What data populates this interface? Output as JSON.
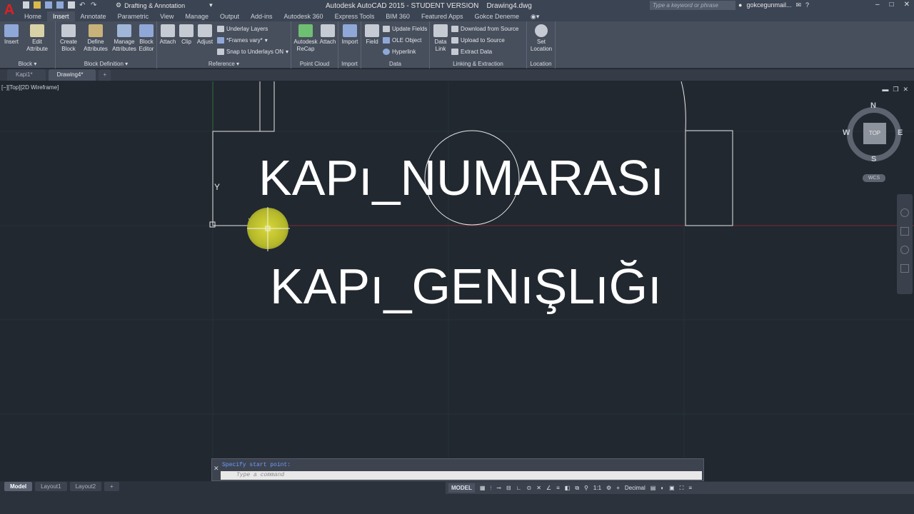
{
  "app": {
    "window_title": "Autodesk AutoCAD 2015 - STUDENT VERSION    Drawing4.dwg",
    "workspace": "Drafting & Annotation",
    "search_placeholder": "Type a keyword or phrase",
    "user": "gokcegunmail...",
    "logo": "A"
  },
  "ribbon_tabs": [
    "Home",
    "Insert",
    "Annotate",
    "Parametric",
    "View",
    "Manage",
    "Output",
    "Add-ins",
    "Autodesk 360",
    "Express Tools",
    "BIM 360",
    "Featured Apps",
    "Gokce Deneme"
  ],
  "active_tab": "Insert",
  "panels": {
    "block": {
      "title": "Block",
      "tools": [
        "Insert",
        "Edit Attribute"
      ]
    },
    "block_definition": {
      "title": "Block Definition",
      "tools": [
        "Create Block",
        "Define Attributes",
        "Manage Attributes",
        "Block Editor"
      ]
    },
    "reference": {
      "title": "Reference",
      "tools": [
        "Attach",
        "Clip",
        "Adjust"
      ],
      "small": [
        "Underlay Layers",
        "*Frames vary*",
        "Snap to Underlays ON"
      ]
    },
    "point_cloud": {
      "title": "Point Cloud",
      "tools": [
        "Autodesk ReCap",
        "Attach"
      ]
    },
    "import": {
      "title": "Import",
      "tools": [
        "Import"
      ]
    },
    "data": {
      "title": "Data",
      "tools": [
        "Field"
      ],
      "small": [
        "Update Fields",
        "OLE Object",
        "Hyperlink"
      ]
    },
    "linking": {
      "title": "Linking & Extraction",
      "tools": [
        "Data Link"
      ],
      "small": [
        "Download from Source",
        "Upload to Source",
        "Extract  Data"
      ]
    },
    "location": {
      "title": "Location",
      "tools": [
        "Set Location"
      ]
    }
  },
  "file_tabs": [
    "Kapi1*",
    "Drawing4*"
  ],
  "active_file_tab": "Drawing4*",
  "viewport_label": "[−][Top][2D Wireframe]",
  "drawing": {
    "attribute_1": "KAPı_NUMARASı",
    "attribute_2": "KAPı_GENıŞLıĞı",
    "ucs_y": "Y"
  },
  "viewcube": {
    "top": "TOP",
    "n": "N",
    "s": "S",
    "e": "E",
    "w": "W",
    "wcs": "WCS"
  },
  "command": {
    "history": "Specify start point:",
    "placeholder": "Type a command"
  },
  "layout_tabs": [
    "Model",
    "Layout1",
    "Layout2"
  ],
  "active_layout": "Model",
  "status": {
    "model": "MODEL",
    "scale": "1:1",
    "units": "Decimal"
  },
  "colors": {
    "canvas": "#212830",
    "ribbon": "#474f5d",
    "accent_red_axis": "#8b2a2a",
    "cursor_halo": "#d8d83a"
  }
}
